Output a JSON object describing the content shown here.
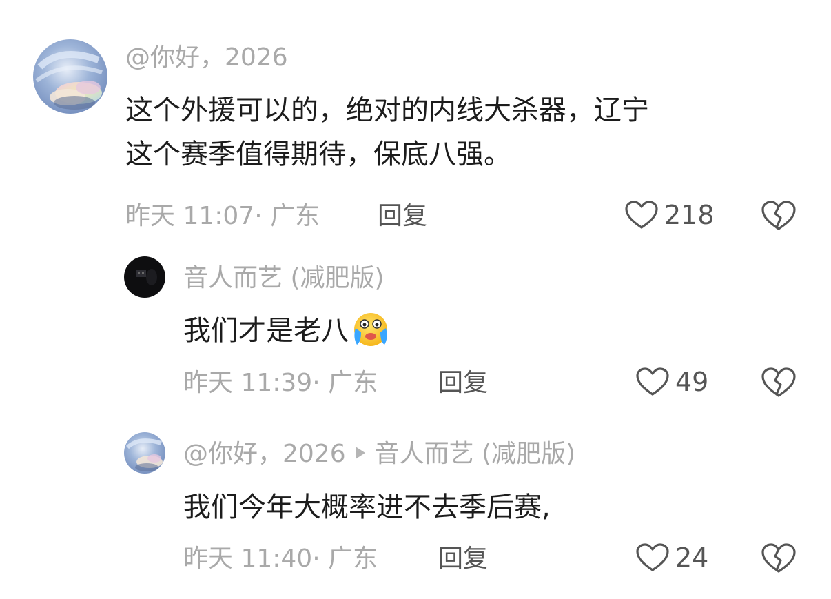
{
  "comments": [
    {
      "username": "@你好，2026",
      "lines": [
        "这个外援可以的，绝对的内线大杀器，辽宁",
        "这个赛季值得期待，保底八强。"
      ],
      "time_location": "昨天 11:07· 广东",
      "reply_label": "回复",
      "likes": "218"
    },
    {
      "username": "音人而艺 (减肥版)",
      "text": "我们才是老八",
      "emoji": "crying-face-emoji",
      "time_location": "昨天 11:39· 广东",
      "reply_label": "回复",
      "likes": "49"
    },
    {
      "username": "@你好，2026",
      "reply_to": "音人而艺 (减肥版)",
      "text": "我们今年大概率进不去季后赛,",
      "time_location": "昨天 11:40· 广东",
      "reply_label": "回复",
      "likes": "24"
    }
  ],
  "icons": {
    "like": "heart-outline-icon",
    "dislike": "broken-heart-icon",
    "reply_arrow": "triangle-right-icon"
  },
  "colors": {
    "text": "#1c1c1c",
    "muted": "#a9a9a9",
    "action": "#555555"
  }
}
